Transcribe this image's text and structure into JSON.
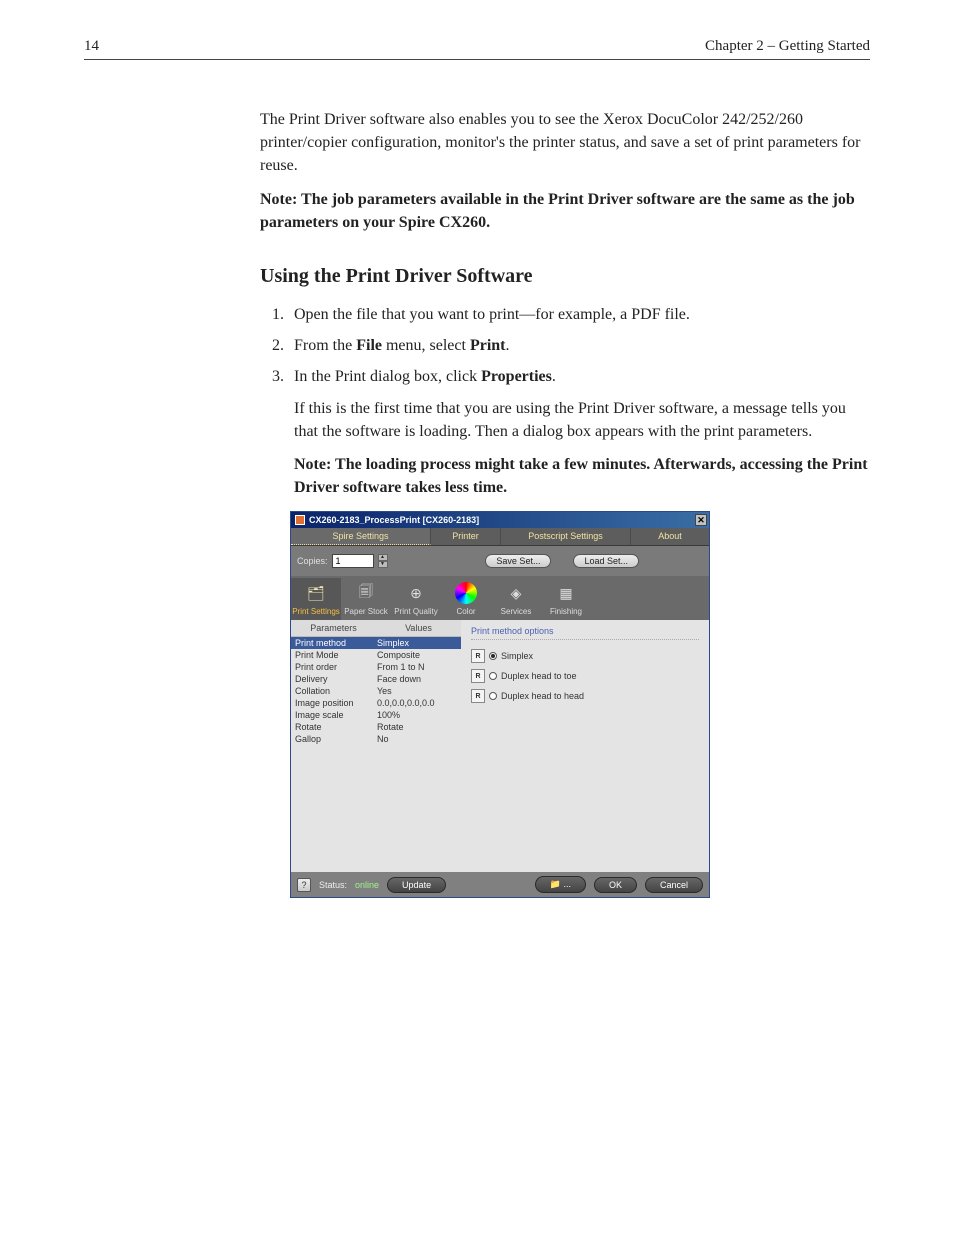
{
  "header": {
    "page_number": "14",
    "chapter": "Chapter 2 – Getting Started"
  },
  "intro": {
    "para1": "The Print Driver software also enables you to see the Xerox DocuColor 242/252/260 printer/copier configuration, monitor's the printer status, and save a set of print parameters for reuse.",
    "note_label": "Note:",
    "note_text": " The job parameters available in the Print Driver software are the same as the job parameters on your Spire CX260."
  },
  "section": {
    "title": "Using the Print Driver Software",
    "steps": [
      "Open the file that you want to print—for example, a PDF file.",
      {
        "pre": "From the ",
        "b1": "File",
        "mid": " menu, select ",
        "b2": "Print",
        "post": "."
      },
      {
        "pre": "In the Print dialog box, click ",
        "b1": "Properties",
        "post": "."
      }
    ],
    "after3": "If this is the first time that you are using the Print Driver software, a message tells you that the software is loading. Then a dialog box appears with the print parameters.",
    "note2_label": "Note:",
    "note2_text": " The loading process might take a few minutes. Afterwards, accessing the Print Driver software takes less time."
  },
  "dialog": {
    "title": "CX260-2183_ProcessPrint [CX260-2183]",
    "tabs": [
      "Spire Settings",
      "Printer",
      "Postscript Settings",
      "About"
    ],
    "copies_label": "Copies:",
    "copies_value": "1",
    "save_set": "Save Set...",
    "load_set": "Load Set...",
    "categories": [
      "Print Settings",
      "Paper Stock",
      "Print Quality",
      "Color",
      "Services",
      "Finishing"
    ],
    "col_headers": {
      "p": "Parameters",
      "v": "Values"
    },
    "params": [
      {
        "name": "Print method",
        "value": "Simplex",
        "selected": true
      },
      {
        "name": "Print Mode",
        "value": "Composite"
      },
      {
        "name": "Print order",
        "value": "From 1 to N"
      },
      {
        "name": "Delivery",
        "value": "Face down"
      },
      {
        "name": "Collation",
        "value": "Yes"
      },
      {
        "name": "Image position",
        "value": "0.0,0.0,0.0,0.0"
      },
      {
        "name": "Image scale",
        "value": "100%"
      },
      {
        "name": "Rotate",
        "value": "Rotate"
      },
      {
        "name": "Gallop",
        "value": "No"
      }
    ],
    "group_label": "Print method options",
    "radios": [
      {
        "label": "Simplex",
        "checked": true
      },
      {
        "label": "Duplex head to toe",
        "checked": false
      },
      {
        "label": "Duplex head to head",
        "checked": false
      }
    ],
    "footer": {
      "status_label": "Status:",
      "status_value": "online",
      "update": "Update",
      "save_as": "📁 ...",
      "ok": "OK",
      "cancel": "Cancel"
    }
  }
}
